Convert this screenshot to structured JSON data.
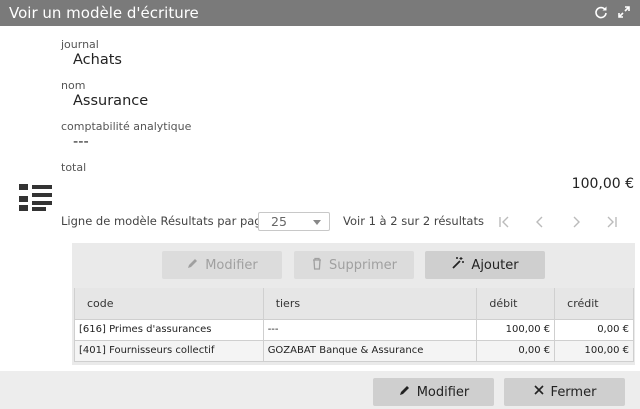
{
  "window": {
    "title": "Voir un modèle d'écriture",
    "refresh_icon": "refresh-icon",
    "expand_icon": "expand-icon"
  },
  "fields": {
    "journal_label": "journal",
    "journal_value": "Achats",
    "nom_label": "nom",
    "nom_value": "Assurance",
    "analytique_label": "comptabilité analytique",
    "analytique_value": "---",
    "total_label": "total",
    "total_value": "100,00 €"
  },
  "pager": {
    "label": "Ligne de modèle Résultats par page",
    "page_size": "25",
    "range": "Voir 1 à 2 sur 2 résultats"
  },
  "toolbar": {
    "modifier": "Modifier",
    "supprimer": "Supprimer",
    "ajouter": "Ajouter"
  },
  "table": {
    "headers": [
      "code",
      "tiers",
      "débit",
      "crédit"
    ],
    "rows": [
      [
        "[616] Primes d'assurances",
        "---",
        "100,00 €",
        "0,00 €"
      ],
      [
        "[401] Fournisseurs collectif",
        "GOZABAT Banque & Assurance",
        "0,00 €",
        "100,00 €"
      ]
    ]
  },
  "footer": {
    "modifier": "Modifier",
    "fermer": "Fermer"
  }
}
